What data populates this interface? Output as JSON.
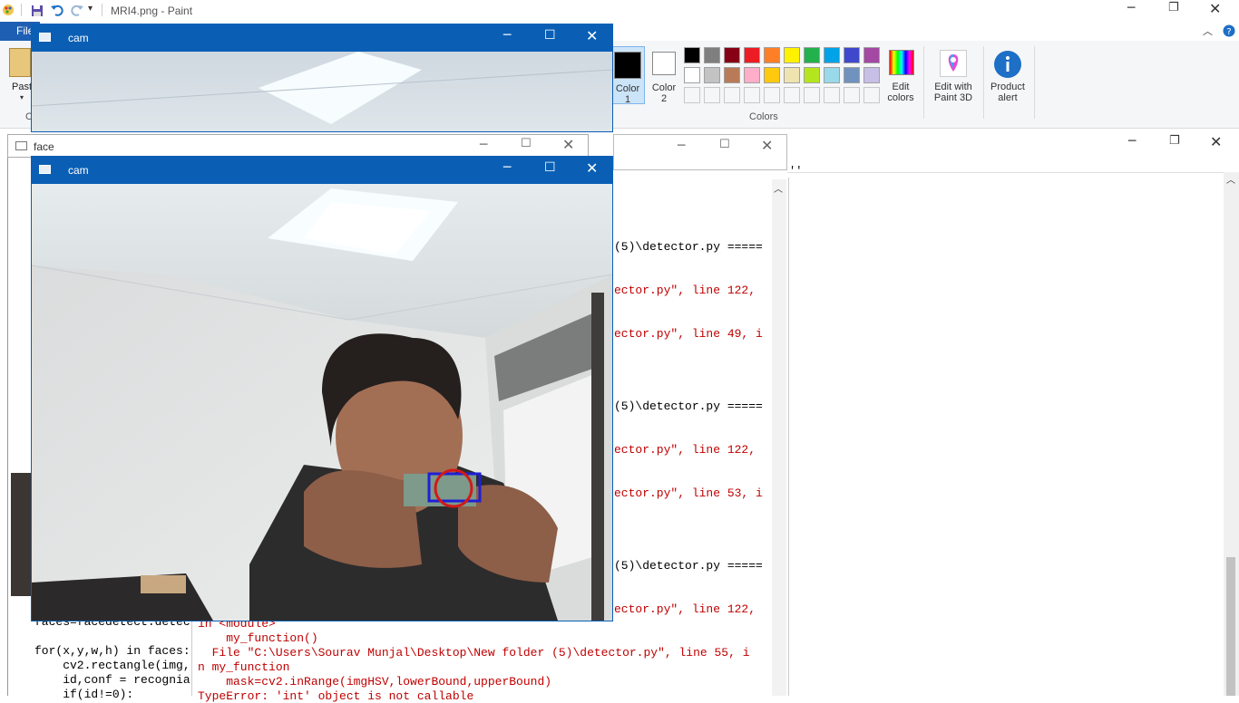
{
  "paint": {
    "title": "MRI4.png - Paint",
    "file_tab": "File",
    "paste_label": "Paste",
    "color1_label": [
      "Color",
      "1"
    ],
    "color2_label": [
      "Color",
      "2"
    ],
    "edit_colors_label": [
      "Edit",
      "colors"
    ],
    "paint3d_label": [
      "Edit with",
      "Paint 3D"
    ],
    "product_alert_label": [
      "Product",
      "alert"
    ],
    "colors_group_label": "Colors",
    "palette_row1": [
      "#000000",
      "#7f7f7f",
      "#880015",
      "#ed1c24",
      "#ff7f27",
      "#fff200",
      "#22b14c",
      "#00a2e8",
      "#3f48cc",
      "#a349a4"
    ],
    "palette_row2": [
      "#ffffff",
      "#c3c3c3",
      "#b97a57",
      "#ffaec9",
      "#ffc90e",
      "#efe4b0",
      "#b5e61d",
      "#99d9ea",
      "#7092be",
      "#c8bfe7"
    ],
    "icons": [
      "paint-app-icon",
      "save-icon",
      "undo-icon",
      "redo-icon",
      "customize-qat-icon",
      "minimize-icon",
      "restore-icon",
      "close-icon",
      "collapse-ribbon-icon",
      "help-icon",
      "paint3d-icon",
      "product-alert-icon"
    ]
  },
  "face_window": {
    "title": "face"
  },
  "cam_window_top": {
    "title": "cam"
  },
  "cam_window": {
    "title": "cam"
  },
  "shell": {
    "right_lines": [
      {
        "text": "(5)\\detector.py =====",
        "color": "#000000"
      },
      {
        "text": "ector.py\", line 122,",
        "color": "#c00000"
      },
      {
        "text": "ector.py\", line 49, i",
        "color": "#c00000"
      },
      {
        "text": "(5)\\detector.py =====",
        "color": "#000000"
      },
      {
        "text": "ector.py\", line 122,",
        "color": "#c00000"
      },
      {
        "text": "ector.py\", line 53, i",
        "color": "#c00000"
      },
      {
        "text": "(5)\\detector.py =====",
        "color": "#000000"
      },
      {
        "text": "ector.py\", line 122,",
        "color": "#c00000"
      }
    ],
    "bottom_lines": [
      "in <module>",
      "    my_function()",
      "  File \"C:\\Users\\Sourav Munjal\\Desktop\\New folder (5)\\detector.py\", line 55, i",
      "n my_function",
      "    mask=cv2.inRange(imgHSV,lowerBound,upperBound)",
      "TypeError: 'int' object is not callable"
    ]
  },
  "editor": {
    "code_lines": [
      "faces=facedetect.detec",
      "",
      "for(x,y,w,h) in faces:",
      "    cv2.rectangle(img,",
      "    id,conf = recognia",
      "    if(id!=0):"
    ],
    "right_fragment": "''"
  }
}
